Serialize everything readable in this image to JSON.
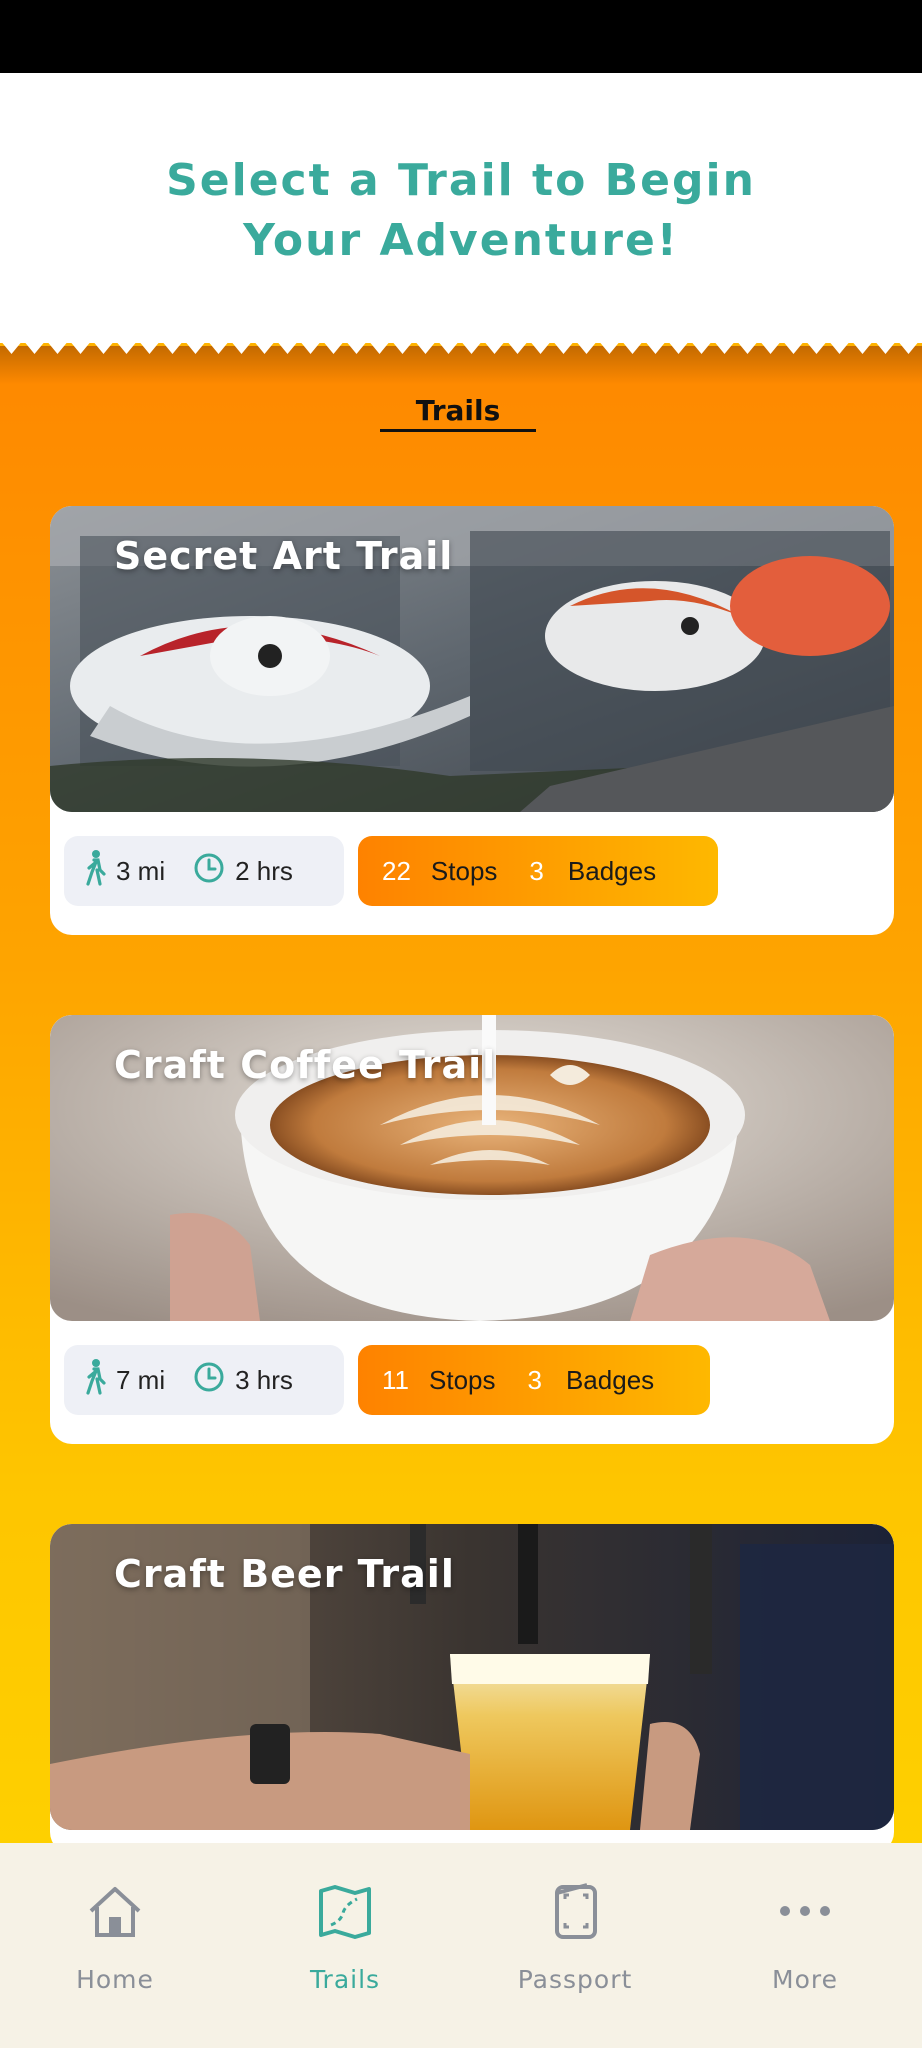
{
  "header": {
    "title_line1": "Select a Trail to Begin",
    "title_line2": "Your Adventure!"
  },
  "section": {
    "title": "Trails"
  },
  "trails": [
    {
      "name": "Secret Art Trail",
      "distance": "3 mi",
      "duration": "2 hrs",
      "stops_count": "22",
      "stops_label": "Stops",
      "badges_count": "3",
      "badges_label": "Badges"
    },
    {
      "name": "Craft Coffee Trail",
      "distance": "7 mi",
      "duration": "3 hrs",
      "stops_count": "11",
      "stops_label": "Stops",
      "badges_count": "3",
      "badges_label": "Badges"
    },
    {
      "name": "Craft Beer Trail"
    }
  ],
  "tabs": [
    {
      "label": "Home",
      "icon": "home-icon"
    },
    {
      "label": "Trails",
      "icon": "map-icon",
      "active": true
    },
    {
      "label": "Passport",
      "icon": "passport-icon"
    },
    {
      "label": "More",
      "icon": "more-icon"
    }
  ],
  "colors": {
    "accent": "#3aaa9c",
    "orange": "#fe8900",
    "yellow": "#fed000",
    "tab_inactive": "#8a8f98"
  }
}
